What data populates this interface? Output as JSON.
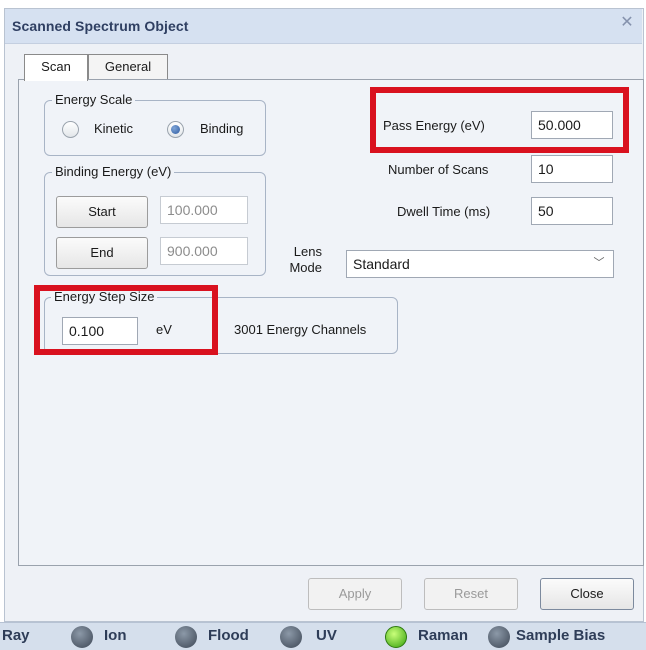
{
  "window": {
    "title": "Scanned Spectrum Object"
  },
  "tabs": [
    {
      "label": "Scan"
    },
    {
      "label": "General"
    }
  ],
  "energy_scale": {
    "title": "Energy Scale",
    "options": [
      {
        "label": "Kinetic",
        "selected": false
      },
      {
        "label": "Binding",
        "selected": true
      }
    ]
  },
  "binding_energy": {
    "title": "Binding Energy (eV)",
    "start_label": "Start",
    "start_value": "100.000",
    "end_label": "End",
    "end_value": "900.000"
  },
  "pass_energy": {
    "label": "Pass Energy (eV)",
    "value": "50.000"
  },
  "num_scans": {
    "label": "Number of Scans",
    "value": "10"
  },
  "dwell_time": {
    "label": "Dwell Time  (ms)",
    "value": "50"
  },
  "lens_mode": {
    "label_line1": "Lens",
    "label_line2": "Mode",
    "value": "Standard"
  },
  "energy_step": {
    "title": "Energy Step Size",
    "value": "0.100",
    "unit": "eV",
    "channels": "3001 Energy Channels"
  },
  "buttons": {
    "apply": "Apply",
    "reset": "Reset",
    "close": "Close"
  },
  "status_bar": {
    "items": [
      {
        "label": "Ray"
      },
      {
        "label": "Ion",
        "active": false
      },
      {
        "label": "Flood",
        "active": false
      },
      {
        "label": "UV",
        "active": false
      },
      {
        "label": "Raman",
        "active": true
      },
      {
        "label": "Sample Bias",
        "active": false
      }
    ]
  },
  "colors": {
    "highlight": "#d9111f",
    "title_text": "#2f3f62",
    "active_indicator": "#36a10e"
  }
}
